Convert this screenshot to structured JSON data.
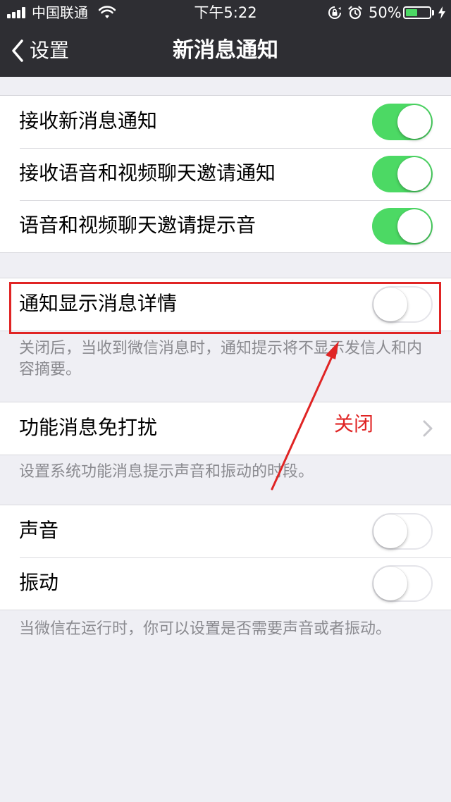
{
  "status_bar": {
    "carrier": "中国联通",
    "time": "下午5:22",
    "battery_percent_text": "50%",
    "battery_level": 0.5,
    "icons": [
      "signal-icon",
      "wifi-icon",
      "rotation-lock-icon",
      "alarm-icon",
      "battery-icon",
      "charging-icon"
    ]
  },
  "nav": {
    "back_label": "设置",
    "title": "新消息通知"
  },
  "group1": {
    "rows": [
      {
        "label": "接收新消息通知",
        "toggle": "on"
      },
      {
        "label": "接收语音和视频聊天邀请通知",
        "toggle": "on"
      },
      {
        "label": "语音和视频聊天邀请提示音",
        "toggle": "on"
      }
    ]
  },
  "group2": {
    "rows": [
      {
        "label": "通知显示消息详情",
        "toggle": "off"
      }
    ],
    "footnote": "关闭后，当收到微信消息时，通知提示将不显示发信人和内容摘要。"
  },
  "group3": {
    "rows": [
      {
        "label": "功能消息免打扰",
        "accessory": "chevron-right-icon"
      }
    ],
    "footnote": "设置系统功能消息提示声音和振动的时段。"
  },
  "group4": {
    "rows": [
      {
        "label": "声音",
        "toggle": "off"
      },
      {
        "label": "振动",
        "toggle": "off"
      }
    ],
    "footnote": "当微信在运行时，你可以设置是否需要声音或者振动。"
  },
  "annotation": {
    "text": "关闭",
    "color": "#e02424"
  },
  "colors": {
    "nav_background": "#2e2e33",
    "page_background": "#efeff4",
    "toggle_on": "#4cd964",
    "annotation_red": "#e02424"
  }
}
